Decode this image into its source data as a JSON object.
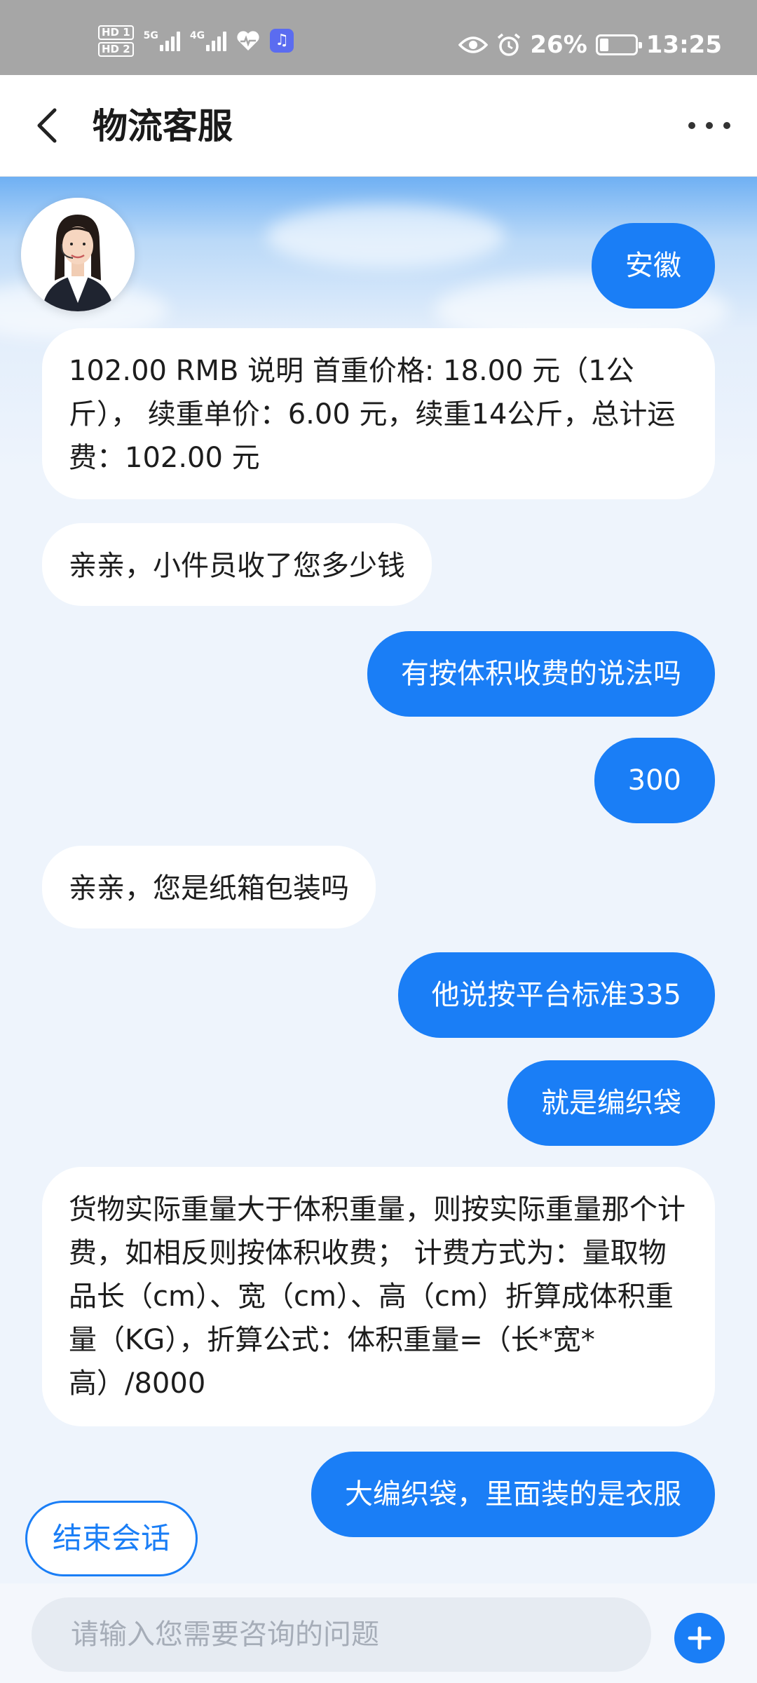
{
  "status_bar": {
    "hd1": "HD 1",
    "hd2": "HD 2",
    "net1": "5G",
    "net2": "4G",
    "battery_percent": "26%",
    "battery_level": 0.26,
    "time": "13:25"
  },
  "header": {
    "title": "物流客服"
  },
  "messages": [
    {
      "side": "out",
      "text": "安徽"
    },
    {
      "side": "in",
      "text": "102.00 RMB 说明 首重价格: 18.00 元（1公斤）， 续重单价：6.00 元，续重14公斤，总计运费：102.00 元"
    },
    {
      "side": "in",
      "text": "亲亲，小件员收了您多少钱"
    },
    {
      "side": "out",
      "text": "有按体积收费的说法吗"
    },
    {
      "side": "out",
      "text": "300"
    },
    {
      "side": "in",
      "text": "亲亲，您是纸箱包装吗"
    },
    {
      "side": "out",
      "text": "他说按平台标准335"
    },
    {
      "side": "out",
      "text": "就是编织袋"
    },
    {
      "side": "in",
      "text": "货物实际重量大于体积重量，则按实际重量那个计费，如相反则按体积收费； 计费方式为：量取物品长（cm）、宽（cm）、高（cm）折算成体积重量（KG），折算公式：体积重量=（长*宽*高）/8000"
    },
    {
      "side": "out",
      "text": "大编织袋，里面装的是衣服"
    }
  ],
  "end_session": {
    "label": "结束会话"
  },
  "input": {
    "placeholder": "请输入您需要咨询的问题",
    "value": ""
  },
  "colors": {
    "accent": "#1a7ef6",
    "status_bar": "#a6a6a6"
  }
}
